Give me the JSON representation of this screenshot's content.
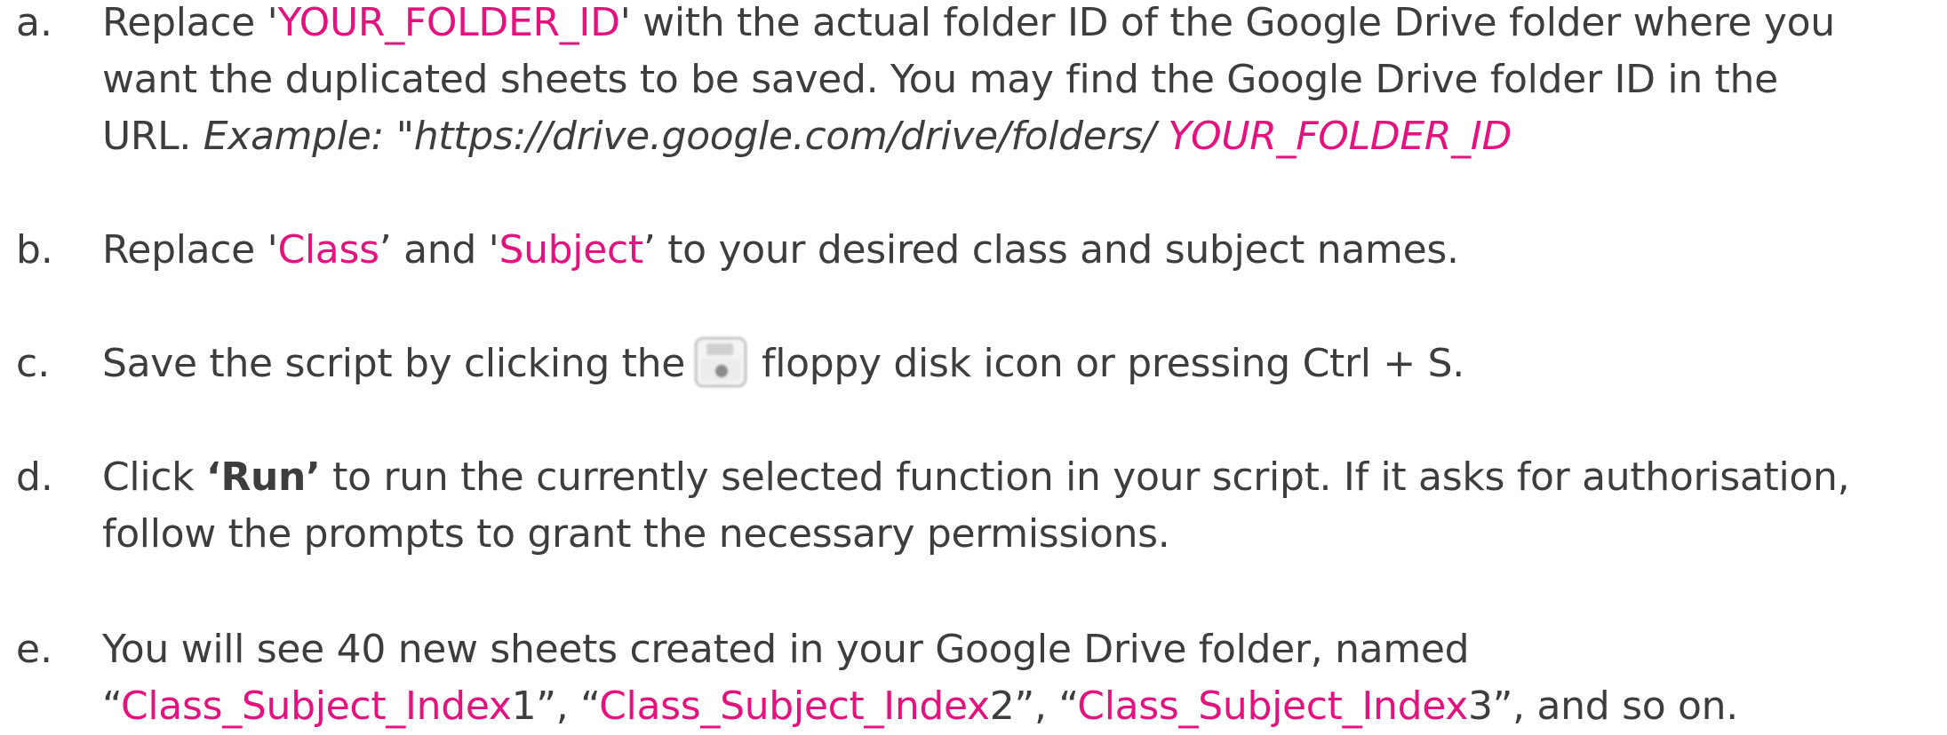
{
  "steps": [
    {
      "marker": "a.",
      "l1_t1": "Replace '",
      "l1_h1": "YOUR_FOLDER_ID",
      "l1_t2": "' with the actual folder ID of the Google Drive folder where you",
      "l2": "want the duplicated sheets to be saved. You may find the Google Drive folder ID in the",
      "l3_t1": "URL. ",
      "l3_it": "Example: \"https://drive.google.com/drive/folders/ ",
      "l3_h1": "YOUR_FOLDER_ID"
    },
    {
      "marker": "b.",
      "t1": "Replace '",
      "h1": "Class",
      "t2": "’ and '",
      "h2": "Subject",
      "t3": "’ to your desired class and subject names."
    },
    {
      "marker": "c.",
      "t1": "Save the script by clicking the",
      "icon": "floppy-disk-icon",
      "t2": "floppy disk icon or pressing Ctrl + S."
    },
    {
      "marker": "d.",
      "t1": "Click ",
      "b1": "‘Run’",
      "t2": " to run the currently selected function in your script. If it asks for authorisation,",
      "l2": "follow the prompts to grant the necessary permissions."
    },
    {
      "marker": "e.",
      "l1": "You will see 40 new sheets created in your Google Drive folder, named",
      "q1": "“",
      "h1": "Class_Subject_Index",
      "n1": "1”, “",
      "h2": "Class_Subject_Index",
      "n2": "2”, “",
      "h3": "Class_Subject_Index",
      "n3": "3”, and so on."
    }
  ],
  "colors": {
    "text": "#3d3d3d",
    "highlight": "#e3127f"
  }
}
